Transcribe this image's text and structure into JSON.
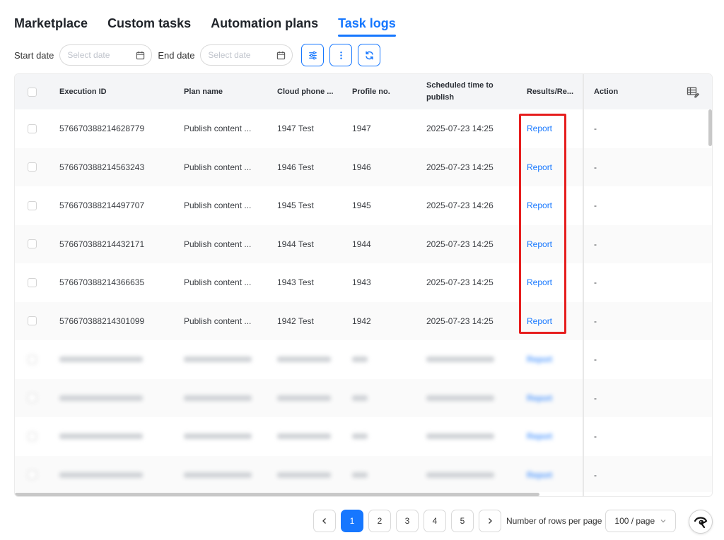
{
  "tabs": [
    {
      "label": "Marketplace",
      "active": false
    },
    {
      "label": "Custom tasks",
      "active": false
    },
    {
      "label": "Automation plans",
      "active": false
    },
    {
      "label": "Task logs",
      "active": true
    }
  ],
  "filters": {
    "start_label": "Start date",
    "start_placeholder": "Select date",
    "end_label": "End date",
    "end_placeholder": "Select date"
  },
  "toolbar_icons": [
    "sliders-icon",
    "more-vertical-icon",
    "refresh-icon"
  ],
  "table": {
    "columns": {
      "execution_id": "Execution ID",
      "plan_name": "Plan name",
      "cloud_phone": "Cloud phone ...",
      "profile_no": "Profile no.",
      "scheduled": "Scheduled time to publish",
      "results": "Results/Re...",
      "action": "Action"
    },
    "rows": [
      {
        "execution_id": "576670388214628779",
        "plan_name": "Publish content ...",
        "cloud_phone": "1947 Test",
        "profile_no": "1947",
        "scheduled": "2025-07-23 14:25",
        "result": "Report",
        "action": "-"
      },
      {
        "execution_id": "576670388214563243",
        "plan_name": "Publish content ...",
        "cloud_phone": "1946 Test",
        "profile_no": "1946",
        "scheduled": "2025-07-23 14:25",
        "result": "Report",
        "action": "-"
      },
      {
        "execution_id": "576670388214497707",
        "plan_name": "Publish content ...",
        "cloud_phone": "1945 Test",
        "profile_no": "1945",
        "scheduled": "2025-07-23 14:26",
        "result": "Report",
        "action": "-"
      },
      {
        "execution_id": "576670388214432171",
        "plan_name": "Publish content ...",
        "cloud_phone": "1944 Test",
        "profile_no": "1944",
        "scheduled": "2025-07-23 14:25",
        "result": "Report",
        "action": "-"
      },
      {
        "execution_id": "576670388214366635",
        "plan_name": "Publish content ...",
        "cloud_phone": "1943 Test",
        "profile_no": "1943",
        "scheduled": "2025-07-23 14:25",
        "result": "Report",
        "action": "-"
      },
      {
        "execution_id": "576670388214301099",
        "plan_name": "Publish content ...",
        "cloud_phone": "1942 Test",
        "profile_no": "1942",
        "scheduled": "2025-07-23 14:25",
        "result": "Report",
        "action": "-"
      }
    ],
    "blurred_rows": [
      {
        "result": "Report",
        "action": "-"
      },
      {
        "result": "Report",
        "action": "-"
      },
      {
        "result": "Report",
        "action": "-"
      },
      {
        "result": "Report",
        "action": "-"
      }
    ]
  },
  "pagination": {
    "pages": [
      "1",
      "2",
      "3",
      "4",
      "5"
    ],
    "current_page": "1",
    "rows_label": "Number of rows per page",
    "page_size": "100 / page"
  },
  "colors": {
    "accent": "#1677ff",
    "highlight": "#e61e1e"
  }
}
